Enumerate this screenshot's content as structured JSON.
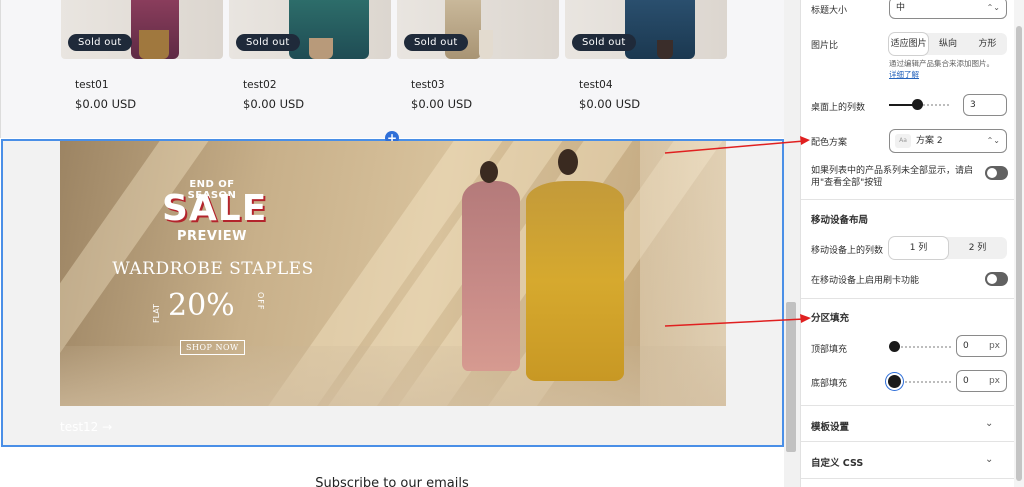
{
  "products": [
    {
      "name": "test01",
      "price": "$0.00 USD",
      "badge": "Sold out"
    },
    {
      "name": "test02",
      "price": "$0.00 USD",
      "badge": "Sold out"
    },
    {
      "name": "test03",
      "price": "$0.00 USD",
      "badge": "Sold out"
    },
    {
      "name": "test04",
      "price": "$0.00 USD",
      "badge": "Sold out"
    }
  ],
  "banner": {
    "eos": "END OF SEASON",
    "sale": "SALE",
    "preview": "PREVIEW",
    "headline": "WARDROBE STAPLES",
    "flat": "FLAT",
    "percent": "20%",
    "off": "OFF",
    "cta": "SHOP NOW"
  },
  "collection_link": "test12 →",
  "subscribe": "Subscribe to our emails",
  "settings": {
    "title_size_label": "标题大小",
    "title_size_value": "中",
    "image_ratio_label": "图片比",
    "image_ratio_options": [
      "适应图片",
      "纵向",
      "方形"
    ],
    "image_ratio_hint": "通过编辑产品集合来添加图片。",
    "image_ratio_link": "详细了解",
    "desktop_columns_label": "桌面上的列数",
    "desktop_columns_value": "3",
    "color_scheme_label": "配色方案",
    "color_scheme_value": "方案 2",
    "view_all_label": "如果列表中的产品系列未全部显示，请启用\"查看全部\"按钮",
    "mobile_layout_heading": "移动设备布局",
    "mobile_columns_label": "移动设备上的列数",
    "mobile_columns_options": [
      "1 列",
      "2 列"
    ],
    "mobile_swipe_label": "在移动设备上启用刷卡功能",
    "padding_heading": "分区填充",
    "top_padding_label": "顶部填充",
    "top_padding_value": "0",
    "bottom_padding_label": "底部填充",
    "bottom_padding_value": "0",
    "unit": "px",
    "template_settings": "模板设置",
    "custom_css": "自定义 CSS"
  },
  "colors": {
    "selection_border": "#4a8fe7",
    "annotation_arrow": "#e02020",
    "badge_bg": "#1f2a3a"
  }
}
